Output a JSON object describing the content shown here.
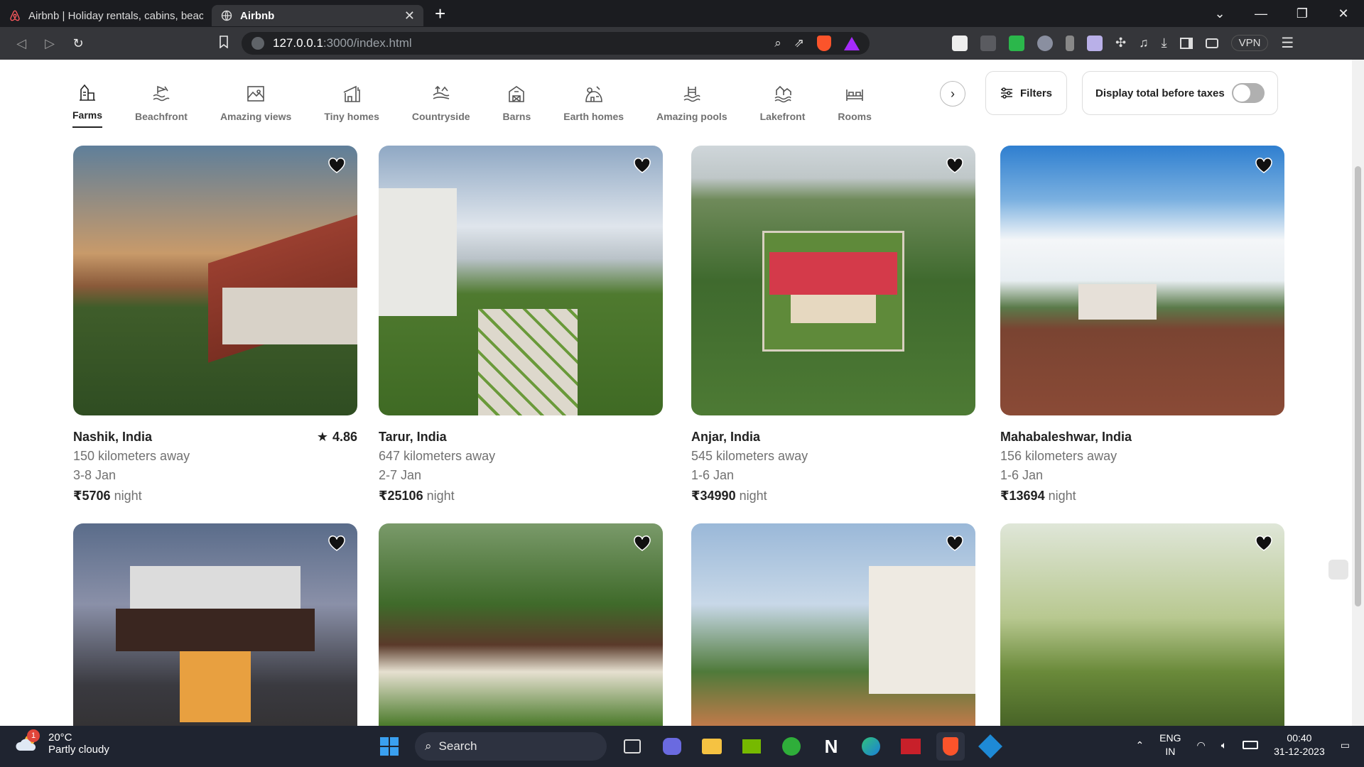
{
  "browser": {
    "tabs": [
      {
        "title": "Airbnb | Holiday rentals, cabins, beach",
        "active": false
      },
      {
        "title": "Airbnb",
        "active": true
      }
    ],
    "url_host": "127.0.0.1",
    "url_path": ":3000/index.html",
    "vpn_label": "VPN"
  },
  "categories": [
    {
      "label": "Farms",
      "icon": "farm-icon",
      "active": true
    },
    {
      "label": "Beachfront",
      "icon": "beachfront-icon",
      "active": false
    },
    {
      "label": "Amazing views",
      "icon": "amazing-views-icon",
      "active": false
    },
    {
      "label": "Tiny homes",
      "icon": "tiny-home-icon",
      "active": false
    },
    {
      "label": "Countryside",
      "icon": "countryside-icon",
      "active": false
    },
    {
      "label": "Barns",
      "icon": "barn-icon",
      "active": false
    },
    {
      "label": "Earth homes",
      "icon": "earth-home-icon",
      "active": false
    },
    {
      "label": "Amazing pools",
      "icon": "pool-icon",
      "active": false
    },
    {
      "label": "Lakefront",
      "icon": "lakefront-icon",
      "active": false
    },
    {
      "label": "Rooms",
      "icon": "room-icon",
      "active": false
    }
  ],
  "filters_label": "Filters",
  "taxes_label": "Display total before taxes",
  "taxes_toggle_on": false,
  "listings": [
    {
      "location": "Nashik, India",
      "rating": "4.86",
      "distance": "150 kilometers away",
      "dates": "3-8 Jan",
      "price": "₹5706",
      "unit": "night"
    },
    {
      "location": "Tarur, India",
      "rating": "",
      "distance": "647 kilometers away",
      "dates": "2-7 Jan",
      "price": "₹25106",
      "unit": "night"
    },
    {
      "location": "Anjar, India",
      "rating": "",
      "distance": "545 kilometers away",
      "dates": "1-6 Jan",
      "price": "₹34990",
      "unit": "night"
    },
    {
      "location": "Mahabaleshwar, India",
      "rating": "",
      "distance": "156 kilometers away",
      "dates": "1-6 Jan",
      "price": "₹13694",
      "unit": "night"
    }
  ],
  "taskbar": {
    "temperature": "20°C",
    "weather": "Partly cloudy",
    "weather_badge": "1",
    "search_label": "Search",
    "lang_top": "ENG",
    "lang_bottom": "IN",
    "time": "00:40",
    "date": "31-12-2023"
  },
  "colors": {
    "browser_bg": "#202124",
    "taskbar_bg": "#1f2430",
    "text_primary": "#222222",
    "text_secondary": "#717171"
  }
}
